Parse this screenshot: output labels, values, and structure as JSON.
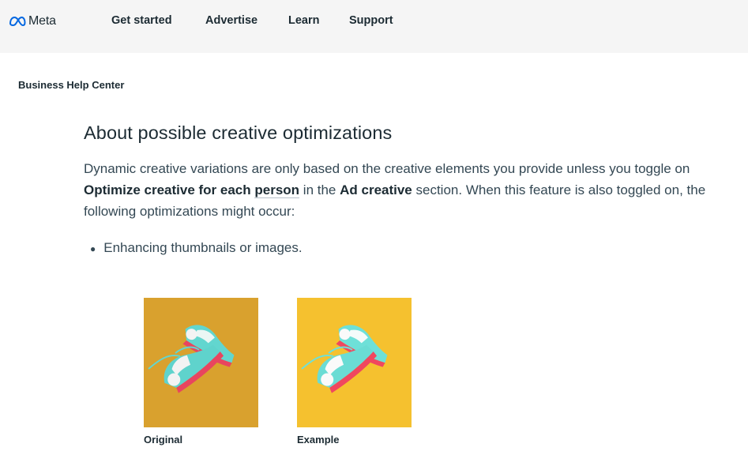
{
  "header": {
    "brand": "Meta",
    "nav": [
      {
        "label": "Get started"
      },
      {
        "label": "Advertise"
      },
      {
        "label": "Learn"
      },
      {
        "label": "Support"
      }
    ]
  },
  "breadcrumb": "Business Help Center",
  "article": {
    "title": "About possible creative optimizations",
    "paragraph": {
      "t1": "Dynamic creative variations are only based on the creative elements you provide unless you toggle on ",
      "b1": "Optimize creative for each ",
      "link": "person",
      "t2": " in the ",
      "b2": "Ad creative",
      "t3": " section. When this feature is also toggled on, the following optimizations might occur:"
    },
    "bullets": [
      "Enhancing thumbnails or images."
    ],
    "figures": [
      {
        "caption": "Original",
        "bg": "#d9a12e"
      },
      {
        "caption": "Example",
        "bg": "#f5c12f"
      }
    ]
  },
  "colors": {
    "nav_bg": "#f5f5f5",
    "text_dark": "#1c2b33",
    "text_body": "#344854",
    "meta_blue": "#0668e1"
  }
}
